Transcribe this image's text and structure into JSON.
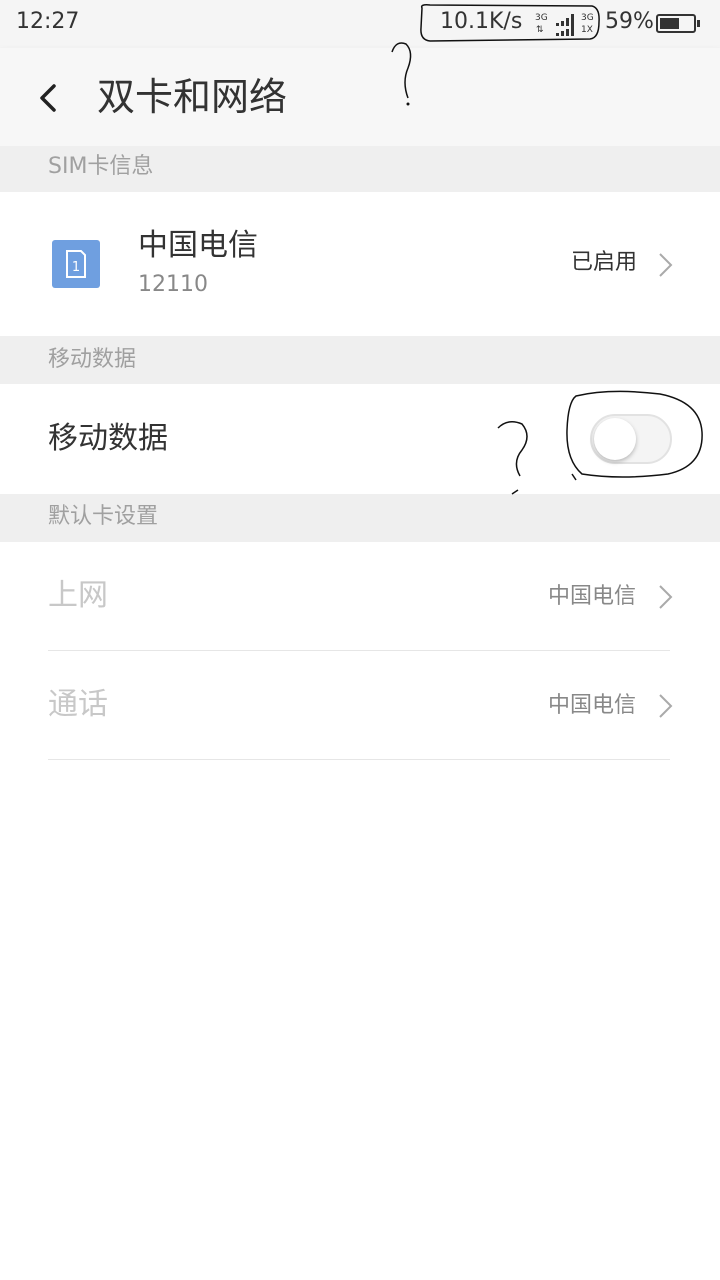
{
  "status_bar": {
    "time": "12:27",
    "net_speed": "10.1K/s",
    "sig1_label": "3G",
    "sig2_label": "3G",
    "sig3_label": "1X",
    "battery": "59%",
    "battery_level": 0.59
  },
  "header": {
    "title": "双卡和网络",
    "back_icon": "chevron-left-icon"
  },
  "sim_section": {
    "header": "SIM卡信息",
    "carrier": "中国电信",
    "number": "12110",
    "sim_badge": "1",
    "status": "已启用"
  },
  "data_section": {
    "header": "移动数据",
    "label": "移动数据",
    "toggle_on": false
  },
  "default_section": {
    "header": "默认卡设置",
    "items": [
      {
        "label": "上网",
        "value": "中国电信"
      },
      {
        "label": "通话",
        "value": "中国电信"
      }
    ]
  },
  "annotations": {
    "mark": "?"
  },
  "colors": {
    "accent": "#6f9fe0",
    "section_bg": "#efefef",
    "text_primary": "#333333",
    "text_disabled": "#c8c8c8"
  }
}
